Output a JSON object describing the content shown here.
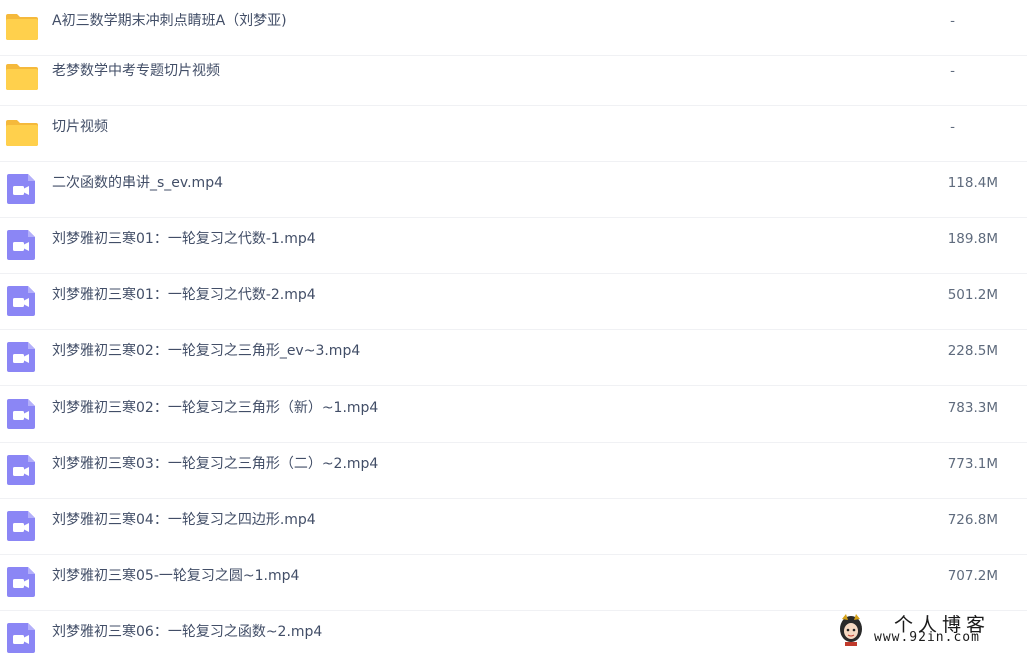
{
  "colors": {
    "folder_icon": "#ffd04c",
    "video_icon": "#8b86f5",
    "text": "#424e67",
    "divider": "#f0f1f4"
  },
  "files": [
    {
      "type": "folder",
      "icon": "folder-icon",
      "name": "A初三数学期末冲刺点睛班A（刘梦亚)",
      "size": "-"
    },
    {
      "type": "folder",
      "icon": "folder-icon",
      "name": "老梦数学中考专题切片视频",
      "size": "-"
    },
    {
      "type": "folder",
      "icon": "folder-icon",
      "name": "切片视频",
      "size": "-"
    },
    {
      "type": "video",
      "icon": "video-file-icon",
      "name": "二次函数的串讲_s_ev.mp4",
      "size": "118.4M"
    },
    {
      "type": "video",
      "icon": "video-file-icon",
      "name": "刘梦雅初三寒01：一轮复习之代数-1.mp4",
      "size": "189.8M"
    },
    {
      "type": "video",
      "icon": "video-file-icon",
      "name": "刘梦雅初三寒01：一轮复习之代数-2.mp4",
      "size": "501.2M"
    },
    {
      "type": "video",
      "icon": "video-file-icon",
      "name": "刘梦雅初三寒02：一轮复习之三角形_ev~3.mp4",
      "size": "228.5M"
    },
    {
      "type": "video",
      "icon": "video-file-icon",
      "name": "刘梦雅初三寒02：一轮复习之三角形（新）~1.mp4",
      "size": "783.3M"
    },
    {
      "type": "video",
      "icon": "video-file-icon",
      "name": "刘梦雅初三寒03：一轮复习之三角形（二）~2.mp4",
      "size": "773.1M"
    },
    {
      "type": "video",
      "icon": "video-file-icon",
      "name": "刘梦雅初三寒04：一轮复习之四边形.mp4",
      "size": "726.8M"
    },
    {
      "type": "video",
      "icon": "video-file-icon",
      "name": "刘梦雅初三寒05-一轮复习之圆~1.mp4",
      "size": "707.2M"
    },
    {
      "type": "video",
      "icon": "video-file-icon",
      "name": "刘梦雅初三寒06：一轮复习之函数~2.mp4",
      "size": ""
    }
  ],
  "watermark": {
    "title": "个人博客",
    "url": "www.92in.com",
    "icon": "cartoon-mascot-icon"
  }
}
